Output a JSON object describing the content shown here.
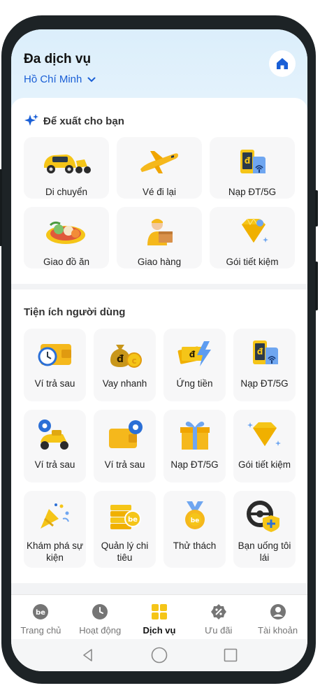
{
  "header": {
    "title": "Đa dịch vụ",
    "city": "Hồ Chí Minh"
  },
  "recommend": {
    "title": "Để xuất cho bạn",
    "items": [
      {
        "label": "Di chuyển",
        "icon": "car-bike-icon"
      },
      {
        "label": "Vé đi lại",
        "icon": "airplane-icon"
      },
      {
        "label": "Nạp ĐT/5G",
        "icon": "phone-topup-icon"
      },
      {
        "label": "Giao đồ ăn",
        "icon": "food-icon"
      },
      {
        "label": "Giao hàng",
        "icon": "delivery-icon"
      },
      {
        "label": "Gói tiết kiệm",
        "icon": "diamond-icon"
      }
    ]
  },
  "utilities": {
    "title": "Tiện ích người dùng",
    "items": [
      {
        "label": "Ví trả sau",
        "icon": "wallet-clock-icon"
      },
      {
        "label": "Vay nhanh",
        "icon": "money-bag-icon"
      },
      {
        "label": "Ứng tiền",
        "icon": "cash-flash-icon"
      },
      {
        "label": "Nạp ĐT/5G",
        "icon": "phone-topup-icon"
      },
      {
        "label": "Ví trả sau",
        "icon": "scooter-gear-icon"
      },
      {
        "label": "Ví trả sau",
        "icon": "wallet-gear-icon"
      },
      {
        "label": "Nạp ĐT/5G",
        "icon": "gift-box-icon"
      },
      {
        "label": "Gói tiết kiệm",
        "icon": "diamond-icon"
      },
      {
        "label": "Khám phá sự kiện",
        "icon": "party-popper-icon"
      },
      {
        "label": "Quản lý chi tiêu",
        "icon": "coins-stack-icon"
      },
      {
        "label": "Thử thách",
        "icon": "medal-icon"
      },
      {
        "label": "Bạn uống tôi lái",
        "icon": "steering-wheel-icon"
      }
    ]
  },
  "bottom_nav": {
    "items": [
      {
        "label": "Trang chủ",
        "icon": "be-logo-icon",
        "active": false
      },
      {
        "label": "Hoạt động",
        "icon": "clock-icon",
        "active": false
      },
      {
        "label": "Dịch vụ",
        "icon": "grid-icon",
        "active": true
      },
      {
        "label": "Ưu đãi",
        "icon": "discount-badge-icon",
        "active": false
      },
      {
        "label": "Tài khoản",
        "icon": "user-icon",
        "active": false
      }
    ]
  },
  "colors": {
    "accent_blue": "#1a5fd6",
    "brand_yellow": "#f5c518",
    "header_bg": "#dbeefb"
  }
}
